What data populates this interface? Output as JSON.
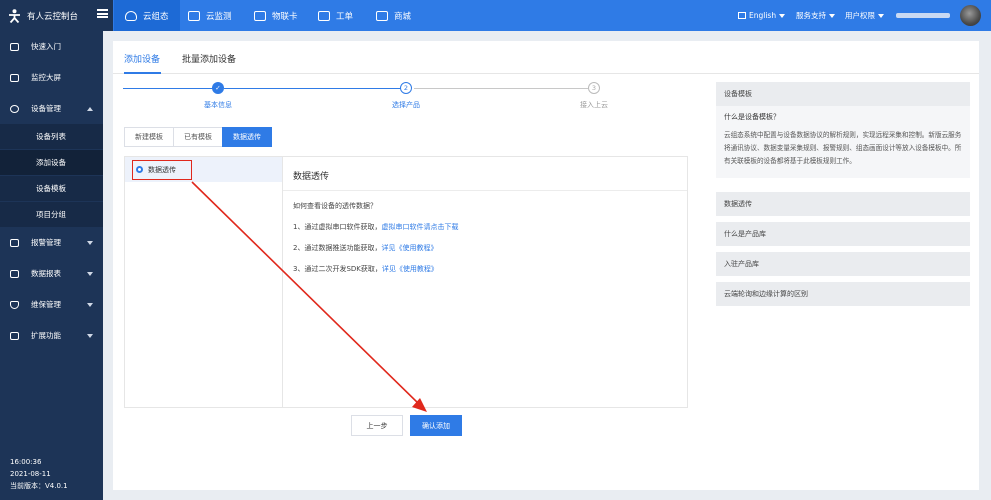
{
  "header": {
    "brand": "有人云控制台",
    "nav": [
      {
        "label": "云组态",
        "icon": "cloud-icon"
      },
      {
        "label": "云监测",
        "icon": "monitor-icon"
      },
      {
        "label": "物联卡",
        "icon": "sim-card-icon"
      },
      {
        "label": "工单",
        "icon": "ticket-icon"
      },
      {
        "label": "商城",
        "icon": "shop-icon"
      }
    ],
    "language": "English",
    "support": "服务支持",
    "permissions": "用户权限"
  },
  "sidebar": {
    "items": [
      {
        "label": "快速入门",
        "icon": "home-icon"
      },
      {
        "label": "监控大屏",
        "icon": "screen-icon"
      },
      {
        "label": "设备管理",
        "icon": "device-icon"
      },
      {
        "label": "报警管理",
        "icon": "alarm-icon"
      },
      {
        "label": "数据报表",
        "icon": "report-icon"
      },
      {
        "label": "维保管理",
        "icon": "shield-icon"
      },
      {
        "label": "扩展功能",
        "icon": "extend-icon"
      }
    ],
    "sub_items": [
      "设备列表",
      "添加设备",
      "设备模板",
      "项目分组"
    ],
    "time": "16:00:36",
    "date": "2021-08-11",
    "version": "当前版本：V4.0.1"
  },
  "main": {
    "tabs": [
      "添加设备",
      "批量添加设备"
    ],
    "steps": [
      {
        "label": "基本信息",
        "num": "✓"
      },
      {
        "label": "选择产品",
        "num": "2"
      },
      {
        "label": "接入上云",
        "num": "3"
      }
    ],
    "subtabs": [
      "新建模板",
      "已有模板",
      "数据透传"
    ],
    "list_item": "数据透传",
    "content_title": "数据透传",
    "question": "如何查看设备的透传数据？",
    "lines": [
      {
        "text": "1、通过虚拟串口软件获取，",
        "link": "虚拟串口软件请点击下载"
      },
      {
        "text": "2、通过数据推送功能获取，",
        "link": "详见《使用教程》"
      },
      {
        "text": "3、通过二次开发SDK获取，",
        "link": "详见《使用教程》"
      }
    ],
    "prev_button": "上一步",
    "confirm_button": "确认添加"
  },
  "help": {
    "header": "设备模板",
    "question": "什么是设备模板？",
    "answer": "云组态系统中配置与设备数据协议的解析规则，实现远程采集和控制。新版云服务将通讯协议、数据变量采集规则、报警规则、组态画面设计等放入设备模板中。所有关联模板的设备都将基于此模板规则工作。",
    "links": [
      "数据透传",
      "什么是产品库",
      "入驻产品库",
      "云端轮询和边缘计算的区别"
    ]
  }
}
